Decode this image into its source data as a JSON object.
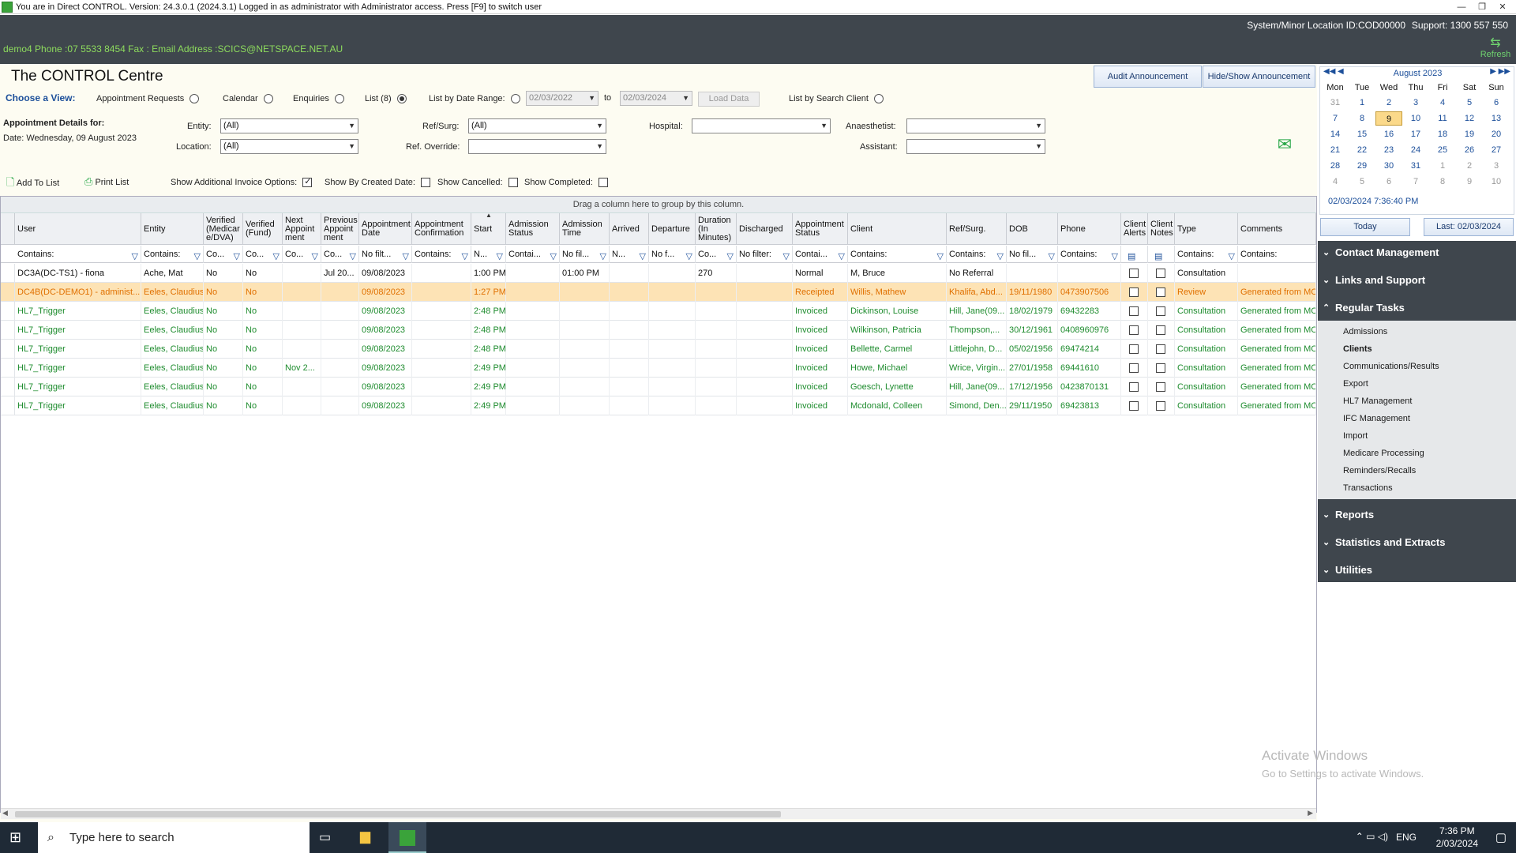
{
  "titlebar": {
    "text": "You are in Direct CONTROL. Version: 24.3.0.1 (2024.3.1) Logged in as administrator with Administrator access. Press [F9] to switch user"
  },
  "sysbar": {
    "location": "System/Minor Location ID:COD00000",
    "support": "Support: 1300 557 550"
  },
  "infobar": {
    "text": "demo4  Phone :07 5533 8454  Fax :  Email Address :SCICS@NETSPACE.NET.AU",
    "refresh": "Refresh"
  },
  "page_title": "The CONTROL Centre",
  "view": {
    "choose_label": "Choose a View:",
    "options": [
      "Appointment Requests",
      "Calendar",
      "Enquiries",
      "List (8)"
    ],
    "selected": "List (8)",
    "date_range_label": "List by Date Range:",
    "from": "02/03/2022",
    "to_label": "to",
    "to": "02/03/2024",
    "load_data": "Load Data",
    "search_client": "List by Search Client"
  },
  "buttons": {
    "audit": "Audit Announcement",
    "hide_show": "Hide/Show Announcement"
  },
  "details": {
    "heading": "Appointment Details for:",
    "date": "Date: Wednesday, 09 August 2023"
  },
  "filters": {
    "entity_label": "Entity:",
    "entity": "(All)",
    "location_label": "Location:",
    "location": "(All)",
    "refsurg_label": "Ref/Surg:",
    "refsurg": "(All)",
    "refoverride_label": "Ref. Override:",
    "refoverride": "",
    "hospital_label": "Hospital:",
    "hospital": "",
    "anaesthetist_label": "Anaesthetist:",
    "anaesthetist": "",
    "assistant_label": "Assistant:",
    "assistant": ""
  },
  "toolbar": {
    "add": "Add To List",
    "print": "Print List",
    "show_invoice": "Show Additional Invoice Options:",
    "show_created": "Show By Created Date:",
    "show_cancelled": "Show Cancelled:",
    "show_completed": "Show Completed:"
  },
  "grid": {
    "group_hint": "Drag a column here to group by this column.",
    "columns": [
      "User",
      "Entity",
      "Verified\n(Medicar\ne/DVA)",
      "Verified\n(Fund)",
      "Next\nAppoint\nment",
      "Previous\nAppoint\nment",
      "Appointment\nDate",
      "Appointment\nConfirmation",
      "Start",
      "Admission\nStatus",
      "Admission\nTime",
      "Arrived",
      "Departure",
      "Duration\n(In\nMinutes)",
      "Discharged",
      "Appointment\nStatus",
      "Client",
      "Ref/Surg.",
      "DOB",
      "Phone",
      "Client\nAlerts",
      "Client\nNotes",
      "Type",
      "Comments"
    ],
    "filters": [
      "Contains:",
      "Contains:",
      "Co...",
      "Co...",
      "Co...",
      "Co...",
      "No filt...",
      "Contains:",
      "N...",
      "Contai...",
      "No fil...",
      "N...",
      "No f...",
      "Co...",
      "No filter:",
      "Contai...",
      "Contains:",
      "Contains:",
      "No fil...",
      "Contains:",
      "",
      "",
      "Contains:",
      "Contains:"
    ],
    "rows": [
      {
        "style": "normal",
        "cells": [
          "DC3A(DC-TS1) - fiona",
          "Ache, Mat",
          "No",
          "No",
          "",
          "Jul 20...",
          "09/08/2023",
          "",
          "1:00 PM",
          "",
          "01:00 PM",
          "",
          "",
          "270",
          "",
          "Normal",
          "M, Bruce",
          "No Referral",
          "",
          "",
          "",
          "",
          "Consultation",
          ""
        ]
      },
      {
        "style": "sel-row",
        "cells": [
          "DC4B(DC-DEMO1) - administ...",
          "Eeles, Claudius",
          "No",
          "No",
          "",
          "",
          "09/08/2023",
          "",
          "1:27 PM",
          "",
          "",
          "",
          "",
          "",
          "",
          "Receipted",
          "Willis, Mathew",
          "Khalifa, Abd...",
          "19/11/1980",
          "0473907506",
          "",
          "",
          "Review",
          "Generated from MC"
        ]
      },
      {
        "style": "green",
        "cells": [
          "HL7_Trigger",
          "Eeles, Claudius",
          "No",
          "No",
          "",
          "",
          "09/08/2023",
          "",
          "2:48 PM",
          "",
          "",
          "",
          "",
          "",
          "",
          "Invoiced",
          "Dickinson, Louise",
          "Hill, Jane(09...",
          "18/02/1979",
          "69432283",
          "",
          "",
          "Consultation",
          "Generated from MC"
        ]
      },
      {
        "style": "green",
        "cells": [
          "HL7_Trigger",
          "Eeles, Claudius",
          "No",
          "No",
          "",
          "",
          "09/08/2023",
          "",
          "2:48 PM",
          "",
          "",
          "",
          "",
          "",
          "",
          "Invoiced",
          "Wilkinson, Patricia",
          "Thompson,...",
          "30/12/1961",
          "0408960976",
          "",
          "",
          "Consultation",
          "Generated from MC"
        ]
      },
      {
        "style": "green",
        "cells": [
          "HL7_Trigger",
          "Eeles, Claudius",
          "No",
          "No",
          "",
          "",
          "09/08/2023",
          "",
          "2:48 PM",
          "",
          "",
          "",
          "",
          "",
          "",
          "Invoiced",
          "Bellette, Carmel",
          "Littlejohn, D...",
          "05/02/1956",
          "69474214",
          "",
          "",
          "Consultation",
          "Generated from MC"
        ]
      },
      {
        "style": "green",
        "cells": [
          "HL7_Trigger",
          "Eeles, Claudius",
          "No",
          "No",
          "Nov 2...",
          "",
          "09/08/2023",
          "",
          "2:49 PM",
          "",
          "",
          "",
          "",
          "",
          "",
          "Invoiced",
          "Howe, Michael",
          "Wrice, Virgin...",
          "27/01/1958",
          "69441610",
          "",
          "",
          "Consultation",
          "Generated from MC"
        ]
      },
      {
        "style": "green",
        "cells": [
          "HL7_Trigger",
          "Eeles, Claudius",
          "No",
          "No",
          "",
          "",
          "09/08/2023",
          "",
          "2:49 PM",
          "",
          "",
          "",
          "",
          "",
          "",
          "Invoiced",
          "Goesch, Lynette",
          "Hill, Jane(09...",
          "17/12/1956",
          "0423870131",
          "",
          "",
          "Consultation",
          "Generated from MC"
        ]
      },
      {
        "style": "green",
        "cells": [
          "HL7_Trigger",
          "Eeles, Claudius",
          "No",
          "No",
          "",
          "",
          "09/08/2023",
          "",
          "2:49 PM",
          "",
          "",
          "",
          "",
          "",
          "",
          "Invoiced",
          "Mcdonald, Colleen",
          "Simond, Den...",
          "29/11/1950",
          "69423813",
          "",
          "",
          "Consultation",
          "Generated from MC"
        ]
      }
    ]
  },
  "calendar": {
    "month": "August 2023",
    "dow": [
      "Mon",
      "Tue",
      "Wed",
      "Thu",
      "Fri",
      "Sat",
      "Sun"
    ],
    "weeks": [
      [
        "31",
        "1",
        "2",
        "3",
        "4",
        "5",
        "6"
      ],
      [
        "7",
        "8",
        "9",
        "10",
        "11",
        "12",
        "13"
      ],
      [
        "14",
        "15",
        "16",
        "17",
        "18",
        "19",
        "20"
      ],
      [
        "21",
        "22",
        "23",
        "24",
        "25",
        "26",
        "27"
      ],
      [
        "28",
        "29",
        "30",
        "31",
        "1",
        "2",
        "3"
      ],
      [
        "4",
        "5",
        "6",
        "7",
        "8",
        "9",
        "10"
      ]
    ],
    "today_day": "9",
    "stamp": "02/03/2024 7:36:40 PM",
    "today_btn": "Today",
    "last_btn": "Last: 02/03/2024"
  },
  "panel": {
    "sections_top": [
      "Contact Management",
      "Links and Support",
      "Regular Tasks"
    ],
    "regular_tasks": [
      "Admissions",
      "Clients",
      "Communications/Results",
      "Export",
      "HL7 Management",
      "IFC Management",
      "Import",
      "Medicare Processing",
      "Reminders/Recalls",
      "Transactions"
    ],
    "bold_item": "Clients",
    "sections_bottom": [
      "Reports",
      "Statistics and Extracts",
      "Utilities"
    ]
  },
  "watermark": {
    "line1": "Activate Windows",
    "line2": "Go to Settings to activate Windows."
  },
  "taskbar": {
    "search": "Type here to search",
    "lang": "ENG",
    "time": "7:36 PM",
    "date": "2/03/2024"
  },
  "colors": {
    "green_text": "#1e8c2e",
    "selected_row_bg": "#fde3b5",
    "selected_row_text": "#e07000",
    "panel_bg": "#3f464d",
    "accent": "#1c4f9a"
  }
}
